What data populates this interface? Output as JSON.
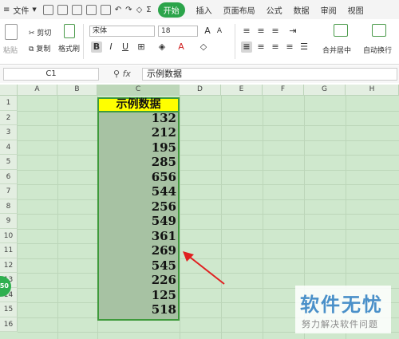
{
  "menu": {
    "file": "文件",
    "tabs": [
      "开始",
      "插入",
      "页面布局",
      "公式",
      "数据",
      "审阅",
      "视图"
    ]
  },
  "ribbon": {
    "cut": "剪切",
    "paste": "粘贴",
    "copy": "复制",
    "format_painter": "格式刷",
    "font_name": "宋体",
    "font_size": "18",
    "merge_center": "合并居中",
    "wrap_text": "自动换行"
  },
  "formula_bar": {
    "name_box": "C1",
    "fx": "fx",
    "content": "示例数据"
  },
  "grid": {
    "columns": [
      "A",
      "B",
      "C",
      "D",
      "E",
      "F",
      "G",
      "H"
    ],
    "rows": [
      "1",
      "2",
      "3",
      "4",
      "5",
      "6",
      "7",
      "8",
      "9",
      "10",
      "11",
      "12",
      "13",
      "14",
      "15",
      "16"
    ],
    "header_cell": "示例数据",
    "values": [
      "132",
      "212",
      "195",
      "285",
      "656",
      "544",
      "256",
      "549",
      "361",
      "269",
      "545",
      "226",
      "125",
      "518"
    ]
  },
  "badge": "50",
  "watermark": {
    "title": "软件无忧",
    "subtitle": "努力解决软件问题"
  },
  "colors": {
    "active_tab": "#2ba44a",
    "sheet_bg": "#cfe8cd",
    "selection": "#a7c2a3",
    "header_fill": "#ffff00",
    "arrow": "#e02020"
  }
}
